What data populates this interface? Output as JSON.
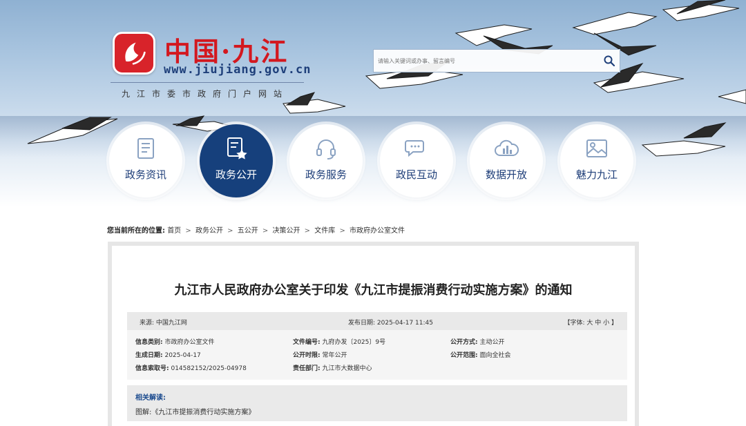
{
  "site": {
    "name": "中国·九江",
    "domain": "www.jiujiang.gov.cn",
    "subtitle": "九江市委市政府门户网站"
  },
  "search": {
    "placeholder": "请输入关键词或办事、留言编号"
  },
  "nav": [
    {
      "label": "政务资讯",
      "icon": "document-icon",
      "active": false
    },
    {
      "label": "政务公开",
      "icon": "document-star-icon",
      "active": true
    },
    {
      "label": "政务服务",
      "icon": "headset-icon",
      "active": false
    },
    {
      "label": "政民互动",
      "icon": "chat-bubbles-icon",
      "active": false
    },
    {
      "label": "数据开放",
      "icon": "cloud-chart-icon",
      "active": false
    },
    {
      "label": "魅力九江",
      "icon": "image-icon",
      "active": false
    }
  ],
  "breadcrumb": {
    "label": "您当前所在的位置:",
    "items": [
      "首页",
      "政务公开",
      "五公开",
      "决策公开",
      "文件库",
      "市政府办公室文件"
    ],
    "separator": ">"
  },
  "article": {
    "title": "九江市人民政府办公室关于印发《九江市提振消费行动实施方案》的通知",
    "source": "来源: 中国九江网",
    "publish_date": "发布日期: 2025-04-17 11:45",
    "font_size": "【字体: 大 中 小 】"
  },
  "info": {
    "category_label": "信息类别:",
    "category": "市政府办公室文件",
    "doc_no_label": "文件编号:",
    "doc_no": "九府办发〔2025〕9号",
    "open_mode_label": "公开方式:",
    "open_mode": "主动公开",
    "created_label": "生成日期:",
    "created": "2025-04-17",
    "open_time_label": "公开时限:",
    "open_time": "常年公开",
    "open_scope_label": "公开范围:",
    "open_scope": "面向全社会",
    "index_label": "信息索取号:",
    "index": "014582152/2025-04978",
    "dept_label": "责任部门:",
    "dept": "九江市大数据中心"
  },
  "related": {
    "title": "相关解读:",
    "link": "图解:《九江市提振消费行动实施方案》"
  },
  "colors": {
    "brand_red": "#d3181f",
    "nav_blue": "#16407c",
    "link_blue": "#1d4c8f"
  }
}
